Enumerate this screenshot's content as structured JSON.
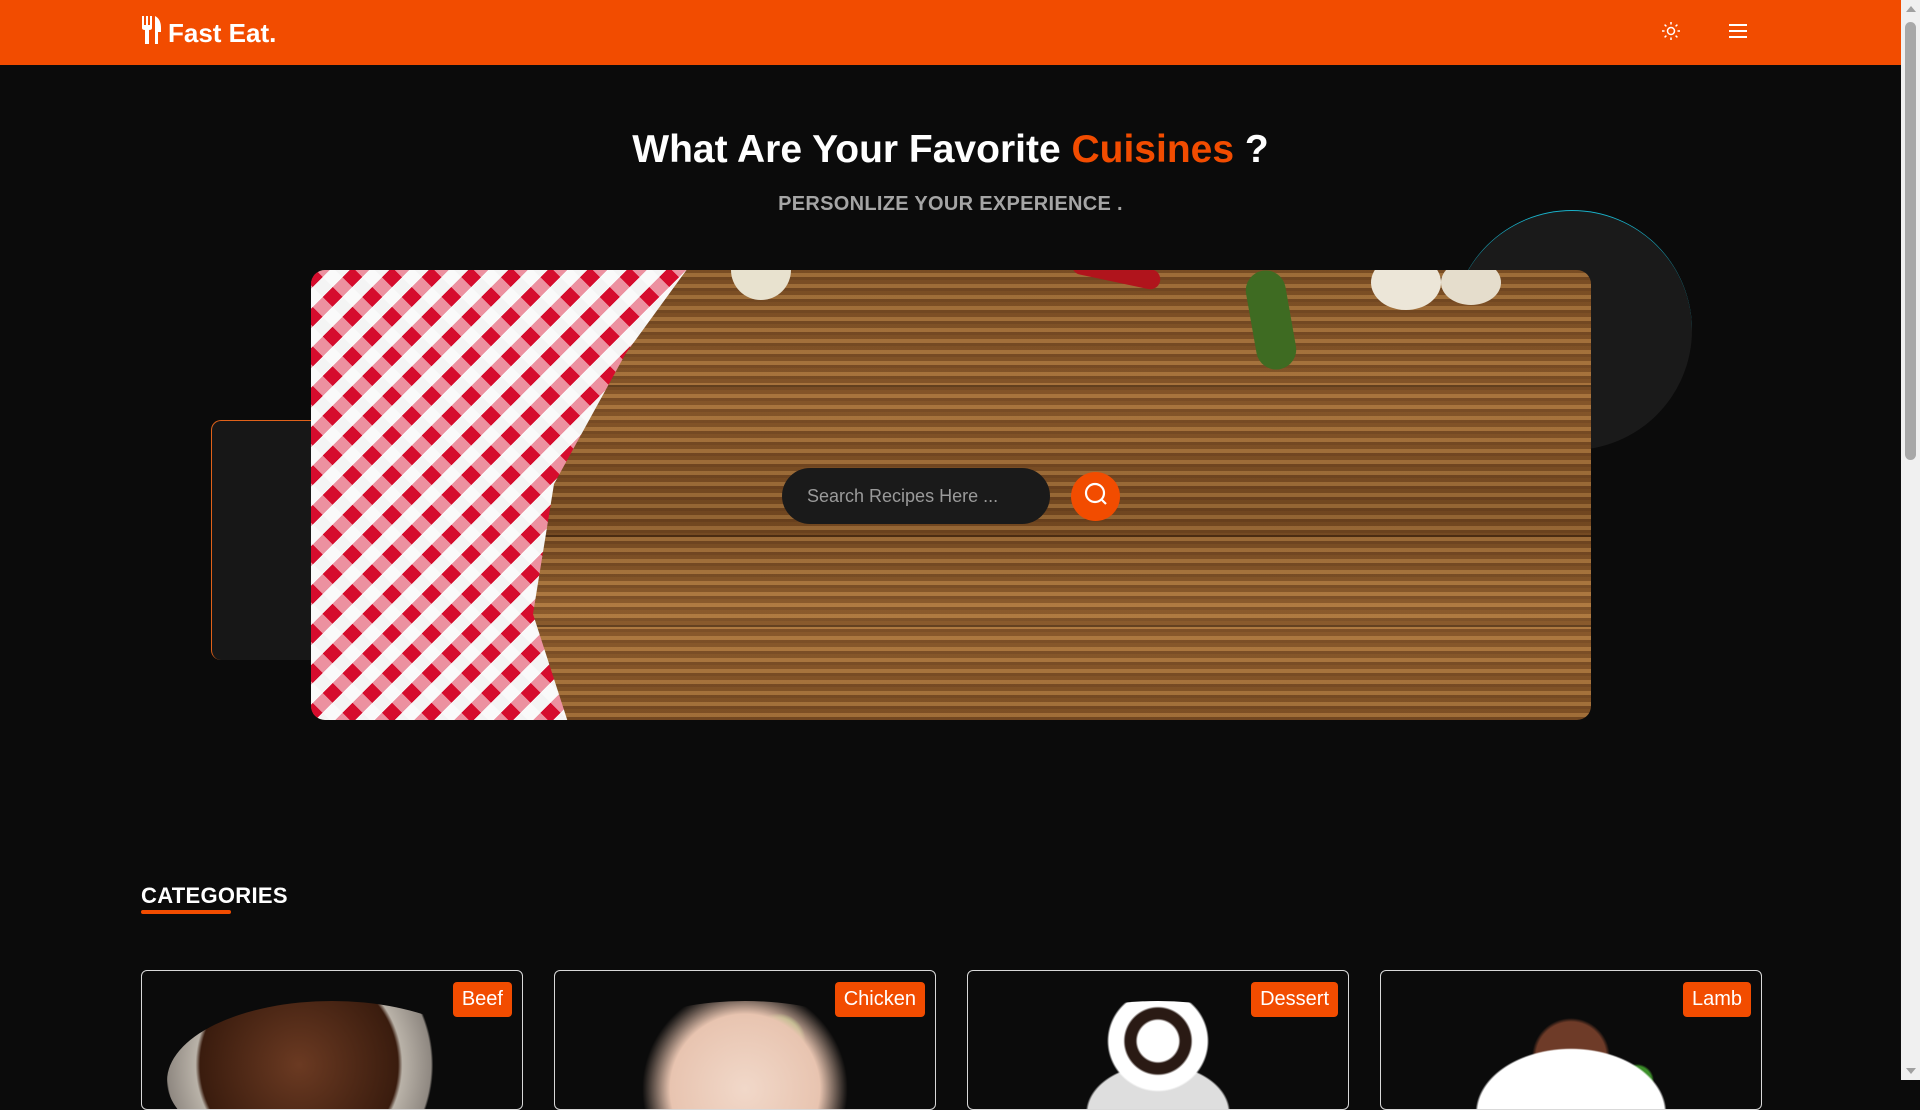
{
  "brand": {
    "name": "Fast Eat."
  },
  "nav": {
    "theme_icon": "sun-icon",
    "menu_icon": "hamburger-menu-icon"
  },
  "hero": {
    "title_prefix": "What Are Your Favorite ",
    "title_accent": "Cuisines",
    "title_suffix": " ?",
    "subtitle": "PERSONLIZE YOUR EXPERIENCE ."
  },
  "search": {
    "placeholder": "Search Recipes Here ...",
    "value": ""
  },
  "categories": {
    "heading": "CATEGORIES",
    "items": [
      {
        "label": "Beef"
      },
      {
        "label": "Chicken"
      },
      {
        "label": "Dessert"
      },
      {
        "label": "Lamb"
      }
    ]
  },
  "colors": {
    "accent": "#f24c00",
    "background": "#0b0b0b",
    "circle_border": "#19b1c9"
  }
}
